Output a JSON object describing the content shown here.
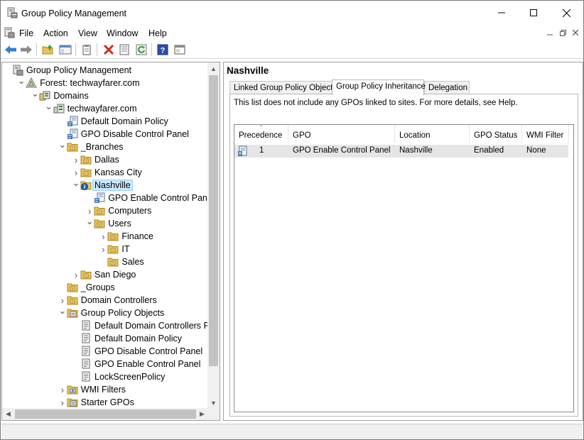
{
  "window": {
    "title": "Group Policy Management"
  },
  "menu": {
    "items": [
      "File",
      "Action",
      "View",
      "Window",
      "Help"
    ]
  },
  "toolbar": {
    "buttons": [
      "back-arrow-icon",
      "forward-arrow-icon",
      "up-folder-icon",
      "show-hide-tree-icon",
      "clipboard-icon",
      "delete-icon",
      "properties-icon",
      "refresh-icon",
      "help-icon",
      "console-icon"
    ]
  },
  "tree": {
    "nodes": [
      {
        "label": "Group Policy Management",
        "icon": "gpm-icon",
        "chevron": ""
      },
      {
        "label": "Forest: techwayfarer.com",
        "icon": "forest-icon",
        "chevron": "down"
      },
      {
        "label": "Domains",
        "icon": "domains-icon",
        "chevron": "down"
      },
      {
        "label": "techwayfarer.com",
        "icon": "domain-icon",
        "chevron": "down"
      },
      {
        "label": "Default Domain Policy",
        "icon": "gpo-link-icon",
        "chevron": ""
      },
      {
        "label": "GPO Disable Control Panel",
        "icon": "gpo-link-icon",
        "chevron": ""
      },
      {
        "label": "_Branches",
        "icon": "ou-folder-icon",
        "chevron": "down"
      },
      {
        "label": "Dallas",
        "icon": "ou-folder-icon",
        "chevron": "right"
      },
      {
        "label": "Kansas City",
        "icon": "ou-folder-icon",
        "chevron": "right"
      },
      {
        "label": "Nashville",
        "icon": "ou-info-icon",
        "chevron": "down"
      },
      {
        "label": "GPO Enable Control Panel",
        "icon": "gpo-link-icon",
        "chevron": ""
      },
      {
        "label": "Computers",
        "icon": "ou-folder-icon",
        "chevron": "right"
      },
      {
        "label": "Users",
        "icon": "ou-folder-icon",
        "chevron": "down"
      },
      {
        "label": "Finance",
        "icon": "ou-folder-icon",
        "chevron": "right"
      },
      {
        "label": "IT",
        "icon": "ou-folder-icon",
        "chevron": "right"
      },
      {
        "label": "Sales",
        "icon": "ou-folder-icon",
        "chevron": ""
      },
      {
        "label": "San Diego",
        "icon": "ou-folder-icon",
        "chevron": "right"
      },
      {
        "label": "_Groups",
        "icon": "ou-folder-icon",
        "chevron": ""
      },
      {
        "label": "Domain Controllers",
        "icon": "ou-folder-icon",
        "chevron": "right"
      },
      {
        "label": "Group Policy Objects",
        "icon": "gpo-container-icon",
        "chevron": "down"
      },
      {
        "label": "Default Domain Controllers Policy",
        "icon": "gpo-icon",
        "chevron": ""
      },
      {
        "label": "Default Domain Policy",
        "icon": "gpo-icon",
        "chevron": ""
      },
      {
        "label": "GPO Disable Control Panel",
        "icon": "gpo-icon",
        "chevron": ""
      },
      {
        "label": "GPO Enable Control Panel",
        "icon": "gpo-icon",
        "chevron": ""
      },
      {
        "label": "LockScreenPolicy",
        "icon": "gpo-icon",
        "chevron": ""
      },
      {
        "label": "WMI Filters",
        "icon": "wmi-folder-icon",
        "chevron": "right"
      },
      {
        "label": "Starter GPOs",
        "icon": "starter-folder-icon",
        "chevron": "right"
      }
    ],
    "selected": "Nashville"
  },
  "details": {
    "header": "Nashville",
    "tabs": [
      "Linked Group Policy Objects",
      "Group Policy Inheritance",
      "Delegation"
    ],
    "active_tab": "Group Policy Inheritance",
    "note": "This list does not include any GPOs linked to sites. For more details, see Help.",
    "columns": [
      "Precedence",
      "GPO",
      "Location",
      "GPO Status",
      "WMI Filter"
    ],
    "rows": [
      {
        "precedence": "1",
        "gpo": "GPO Enable Control Panel",
        "location": "Nashville",
        "status": "Enabled",
        "wmi": "None"
      }
    ]
  },
  "colors": {
    "selection_bg": "#cce8ff",
    "row_bg": "#e5e5e5",
    "folder_yellow": "#e8c45a"
  }
}
